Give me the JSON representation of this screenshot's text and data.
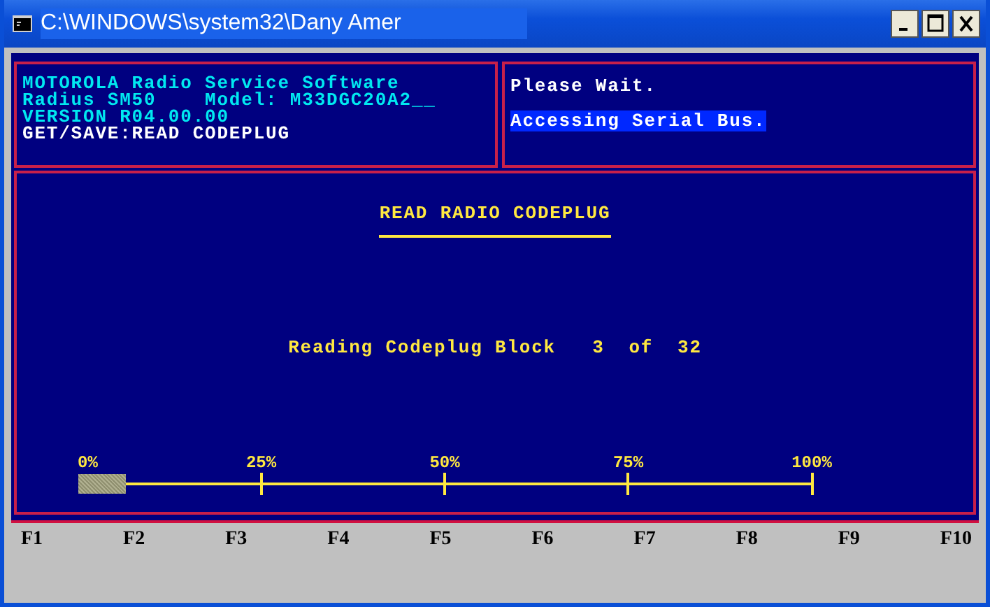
{
  "window": {
    "title": "C:\\WINDOWS\\system32\\Dany Amer"
  },
  "header": {
    "lines": [
      {
        "text": "MOTOROLA Radio Service Software",
        "kind": "info"
      },
      {
        "text": "Radius SM50    Model: M33DGC20A2__",
        "kind": "info"
      },
      {
        "text": "VERSION R04.00.00",
        "kind": "info"
      },
      {
        "text": "GET/SAVE:READ CODEPLUG",
        "kind": "plain"
      }
    ]
  },
  "status": {
    "lines": [
      {
        "text": "Please Wait.",
        "kind": "plain"
      },
      {
        "text": "Accessing Serial Bus.",
        "kind": "highlight"
      }
    ]
  },
  "main": {
    "heading": "READ RADIO CODEPLUG",
    "message": "Reading Codeplug Block   3  of  32",
    "progress": {
      "level": 0.065,
      "ticks": [
        "0%",
        "25%",
        "50%",
        "75%",
        "100%"
      ]
    }
  },
  "function_keys": [
    "F1",
    "F2",
    "F3",
    "F4",
    "F5",
    "F6",
    "F7",
    "F8",
    "F9",
    "F10"
  ]
}
